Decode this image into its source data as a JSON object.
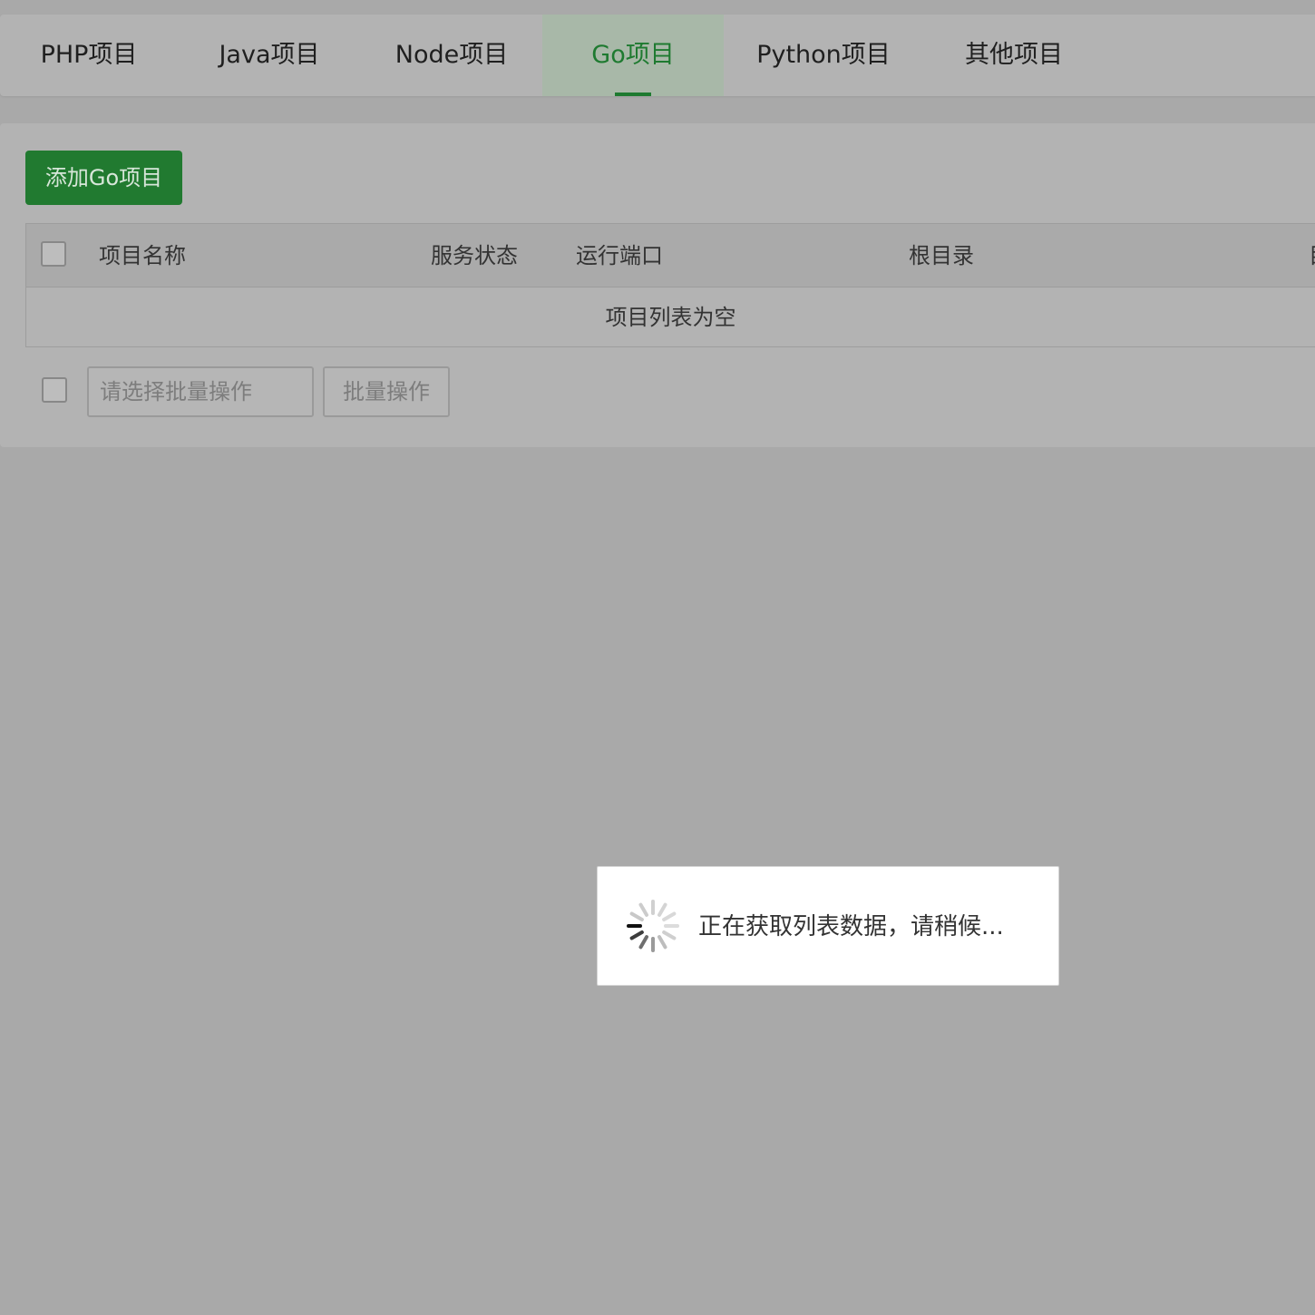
{
  "tabs": [
    {
      "label": "PHP项目",
      "active": false
    },
    {
      "label": "Java项目",
      "active": false
    },
    {
      "label": "Node项目",
      "active": false
    },
    {
      "label": "Go项目",
      "active": true
    },
    {
      "label": "Python项目",
      "active": false
    },
    {
      "label": "其他项目",
      "active": false
    }
  ],
  "toolbar": {
    "add_label": "添加Go项目"
  },
  "table": {
    "columns": [
      "项目名称",
      "服务状态",
      "运行端口",
      "根目录",
      "目"
    ],
    "empty_text": "项目列表为空"
  },
  "batch": {
    "select_placeholder": "请选择批量操作",
    "button_label": "批量操作"
  },
  "loading": {
    "message": "正在获取列表数据，请稍候..."
  },
  "colors": {
    "accent": "#1e7a30",
    "button_bg": "#217a30",
    "overlay_bg": "#a9a9a9"
  }
}
